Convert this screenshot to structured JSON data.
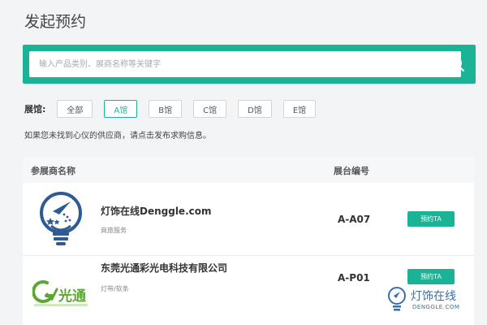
{
  "page": {
    "title": "发起预约"
  },
  "search": {
    "placeholder": "输入产品类别、展商名称等关键字"
  },
  "filters": {
    "label": "展馆:",
    "options": [
      "全部",
      "A馆",
      "B馆",
      "C馆",
      "D馆",
      "E馆"
    ],
    "selected": "A馆"
  },
  "hint": "如果您未找到心仪的供应商，请点击发布求购信息。",
  "table": {
    "headers": {
      "name": "参展商名称",
      "booth": "展台编号"
    },
    "rows": [
      {
        "company": "灯饰在线Denggle.com",
        "category": "商旅服务",
        "booth": "A-A07",
        "action": "预约TA"
      },
      {
        "company": "东莞光通彩光电科技有限公司",
        "category": "灯带/软条",
        "booth": "A-P01",
        "action": "预约TA"
      }
    ]
  },
  "logo2": {
    "text": "光通"
  },
  "watermark": {
    "name": "灯饰在线",
    "domain": "DENGGLE.COM"
  },
  "colors": {
    "accent": "#1bb396",
    "watermark": "#3a6fa8"
  }
}
